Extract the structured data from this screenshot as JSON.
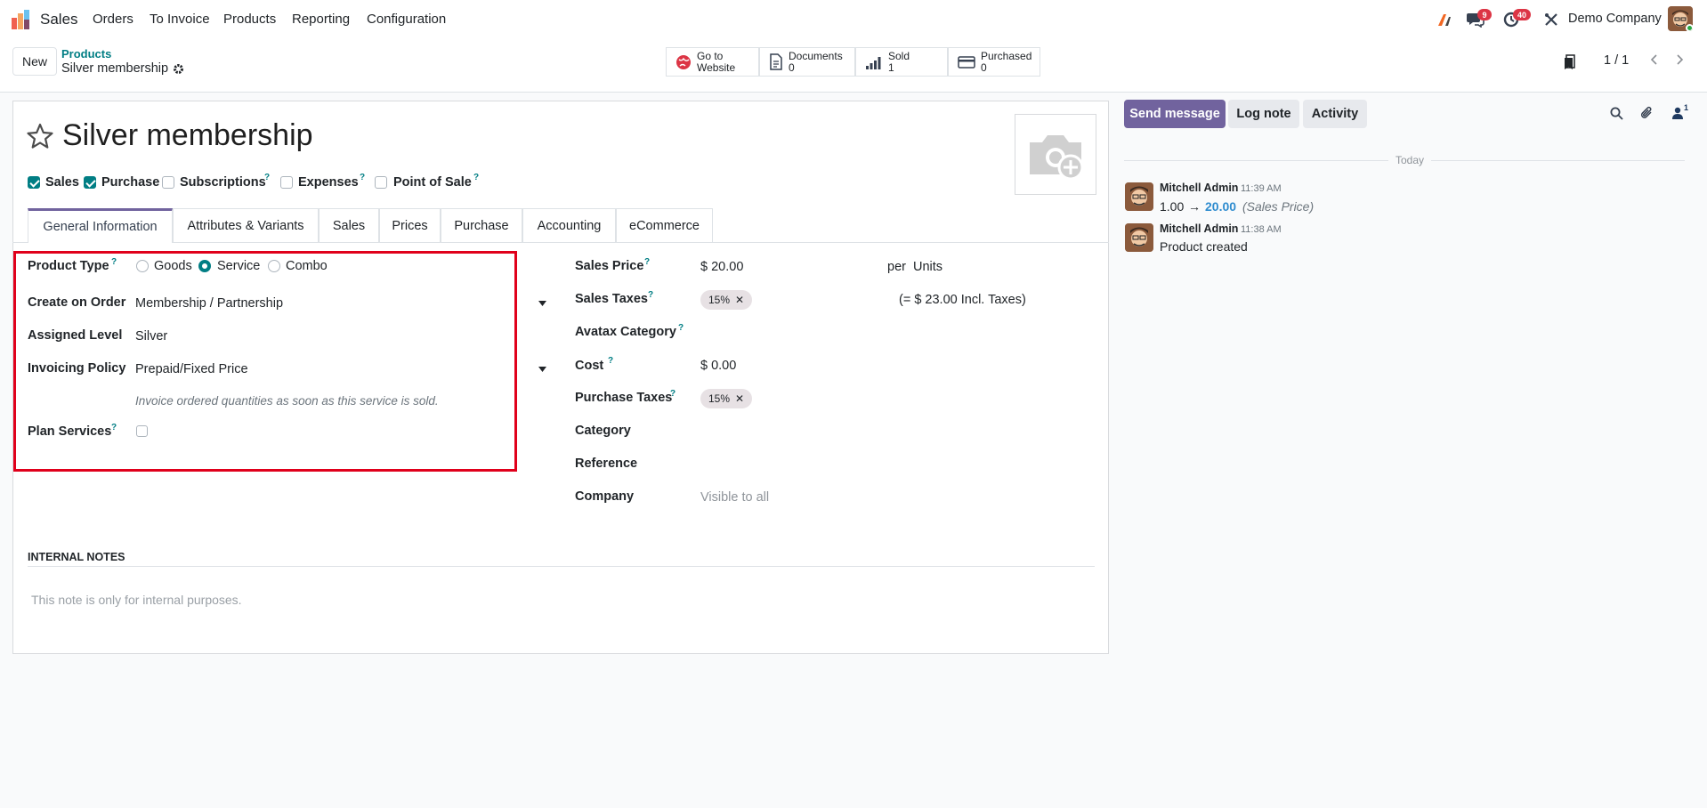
{
  "app": {
    "name": "Sales",
    "menu": [
      "Orders",
      "To Invoice",
      "Products",
      "Reporting",
      "Configuration"
    ]
  },
  "systray": {
    "messages_count": "9",
    "activity_count": "40",
    "company": "Demo Company"
  },
  "control": {
    "new_label": "New",
    "breadcrumb_parent": "Products",
    "breadcrumb_current": "Silver membership",
    "pager": "1 / 1",
    "smart_buttons": [
      {
        "line1": "Go to",
        "line2": "Website"
      },
      {
        "line1": "Documents",
        "line2": "0"
      },
      {
        "line1": "Sold",
        "line2": "1"
      },
      {
        "line1": "Purchased",
        "line2": "0"
      }
    ]
  },
  "product": {
    "name": "Silver membership",
    "options": [
      {
        "label": "Sales",
        "checked": true
      },
      {
        "label": "Purchase",
        "checked": true
      },
      {
        "label": "Subscriptions",
        "checked": false
      },
      {
        "label": "Expenses",
        "checked": false
      },
      {
        "label": "Point of Sale",
        "checked": false
      }
    ]
  },
  "tabs": [
    "General Information",
    "Attributes & Variants",
    "Sales",
    "Prices",
    "Purchase",
    "Accounting",
    "eCommerce"
  ],
  "left": {
    "product_type_label": "Product Type",
    "types": [
      "Goods",
      "Service",
      "Combo"
    ],
    "selected_type": "Service",
    "create_on_order_label": "Create on Order",
    "create_on_order_value": "Membership / Partnership",
    "assigned_level_label": "Assigned Level",
    "assigned_level_value": "Silver",
    "invoicing_policy_label": "Invoicing Policy",
    "invoicing_policy_value": "Prepaid/Fixed Price",
    "invoicing_hint": "Invoice ordered quantities as soon as this service is sold.",
    "plan_services_label": "Plan Services"
  },
  "right": {
    "sales_price_label": "Sales Price",
    "sales_price_value": "$ 20.00",
    "per_label": "per",
    "uom_value": "Units",
    "sales_taxes_label": "Sales Taxes",
    "sales_tax_tag": "15%",
    "incl_taxes_text": "(= $ 23.00 Incl. Taxes)",
    "avatax_label": "Avatax Category",
    "cost_label": "Cost",
    "cost_value": "$ 0.00",
    "purchase_taxes_label": "Purchase Taxes",
    "purchase_tax_tag": "15%",
    "category_label": "Category",
    "reference_label": "Reference",
    "company_label": "Company",
    "company_placeholder": "Visible to all"
  },
  "notes": {
    "title": "INTERNAL NOTES",
    "placeholder": "This note is only for internal purposes."
  },
  "chatter": {
    "send_message": "Send message",
    "log_note": "Log note",
    "activity": "Activity",
    "followers_count": "1",
    "date_separator": "Today",
    "messages": [
      {
        "author": "Mitchell Admin",
        "time": "11:39 AM",
        "old_value": "1.00",
        "arrow": "→",
        "new_value": "20.00",
        "field": "(Sales Price)"
      },
      {
        "author": "Mitchell Admin",
        "time": "11:38 AM",
        "body": "Product created"
      }
    ]
  },
  "colors": {
    "brand": "#71639e",
    "accent": "#017e84",
    "highlight_border": "#e0001b"
  }
}
